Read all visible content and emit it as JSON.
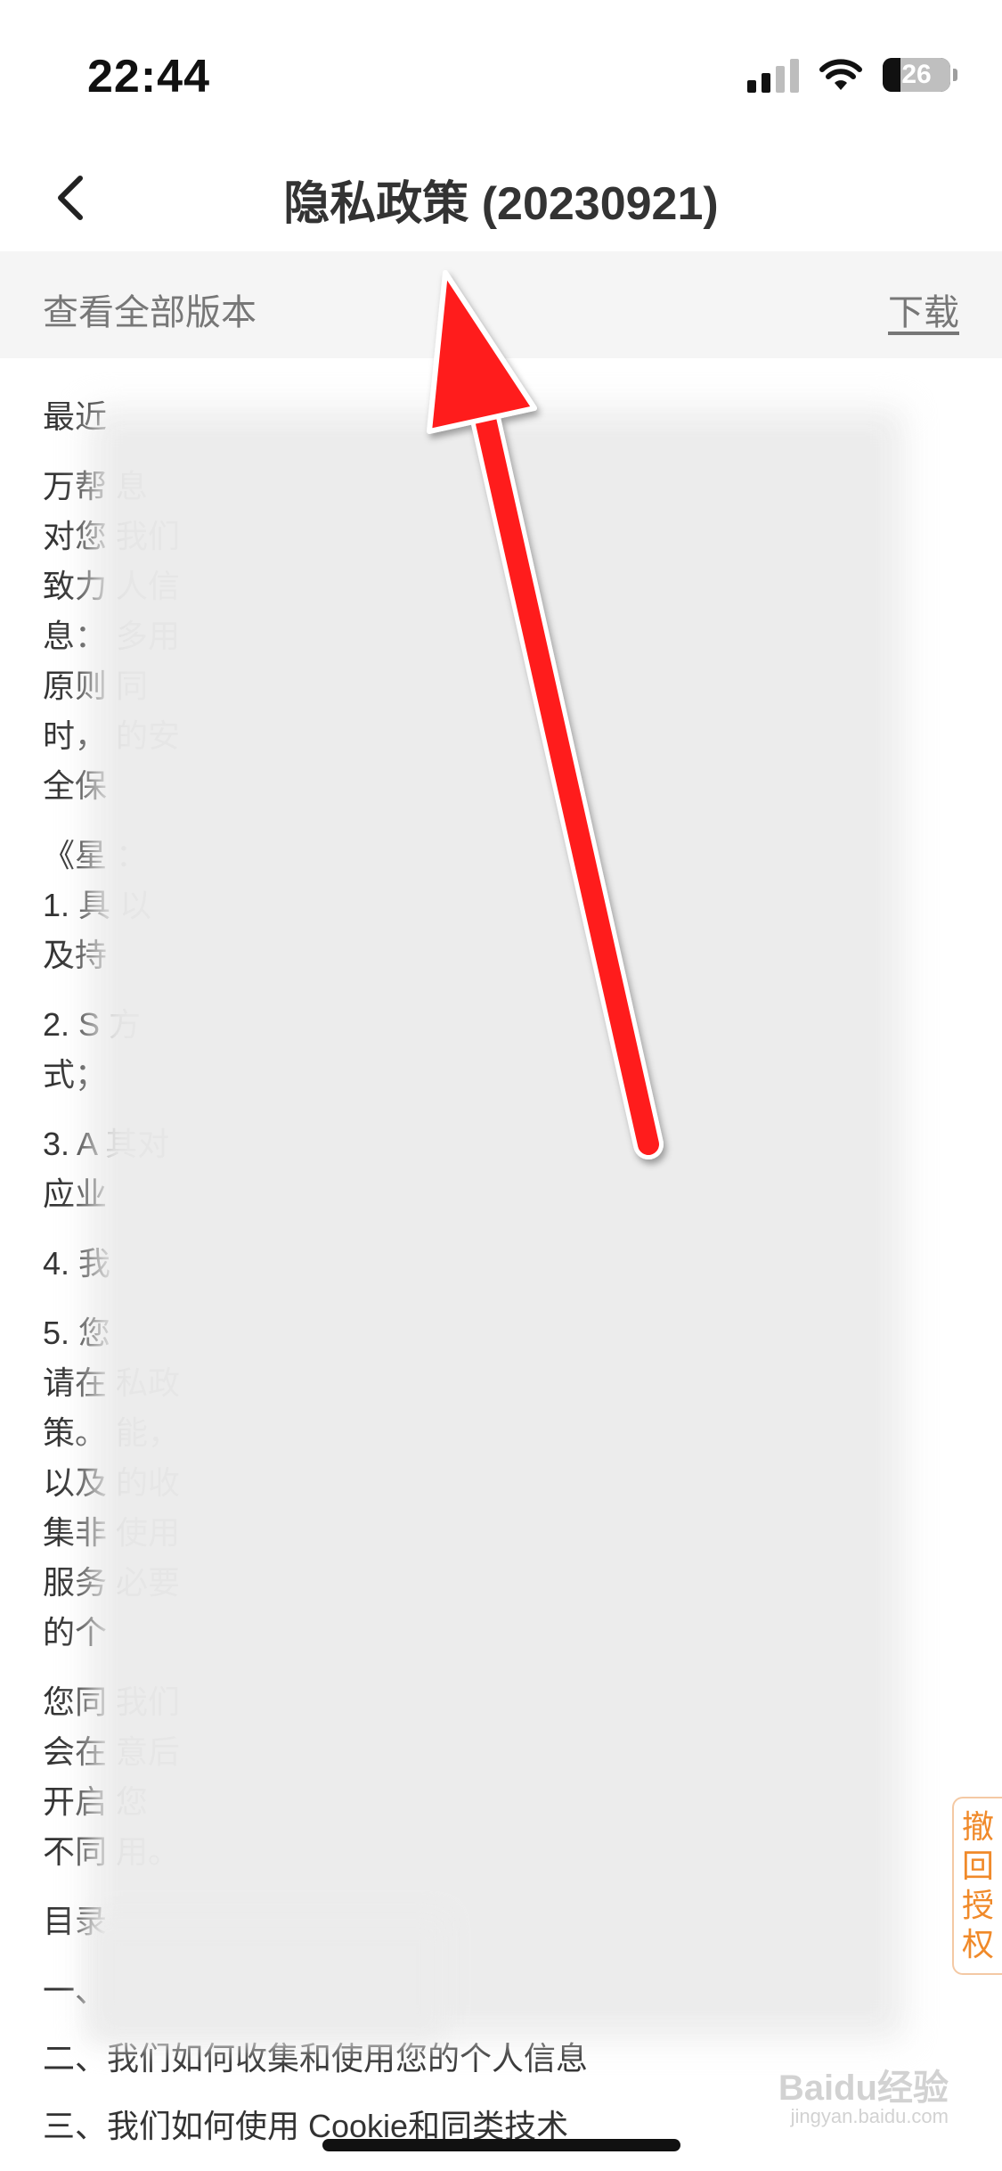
{
  "status_bar": {
    "time": "22:44",
    "battery": "26",
    "battery_level": 0.26
  },
  "header": {
    "title": "隐私政策 (20230921)"
  },
  "version_bar": {
    "view_all_versions": "查看全部版本",
    "download": "下载"
  },
  "content": {
    "lines": [
      "最近",
      "万帮                                          息",
      "对您                                          我们",
      "致力                                          人信",
      "息：                                          多用",
      "原则                                          同",
      "时，                                          的安",
      "全保",
      "《星                                          ：",
      "1. 具                                         以",
      "及持",
      "2. S                                          方",
      "式；",
      "3. A                                          其对",
      "应业",
      "4. 我",
      "5. 您",
      "请在                                          私政",
      "策。                                          能，",
      "以及                                          的收",
      "集非                                          使用",
      "服务                                          必要",
      "的个",
      "您同                                          我们",
      "会在                                          意后",
      "开启                                          您",
      "不同                                          用。",
      "目录"
    ],
    "toc": [
      "一、",
      "二、我们如何收集和使用您的个人信息",
      "三、我们如何使用 Cookie和同类技术"
    ]
  },
  "side_tab": {
    "label": "撤回授权"
  },
  "watermark": {
    "brand": "Baidu经验",
    "sub": "jingyan.baidu.com"
  },
  "colors": {
    "arrow": "#ff1a1a",
    "accent_orange": "#f08a2a",
    "version_bar_bg": "#f5f5f5"
  },
  "icons": {
    "back": "chevron-left-icon",
    "wifi": "wifi-icon",
    "signal": "cellular-signal-icon",
    "battery": "battery-icon"
  }
}
